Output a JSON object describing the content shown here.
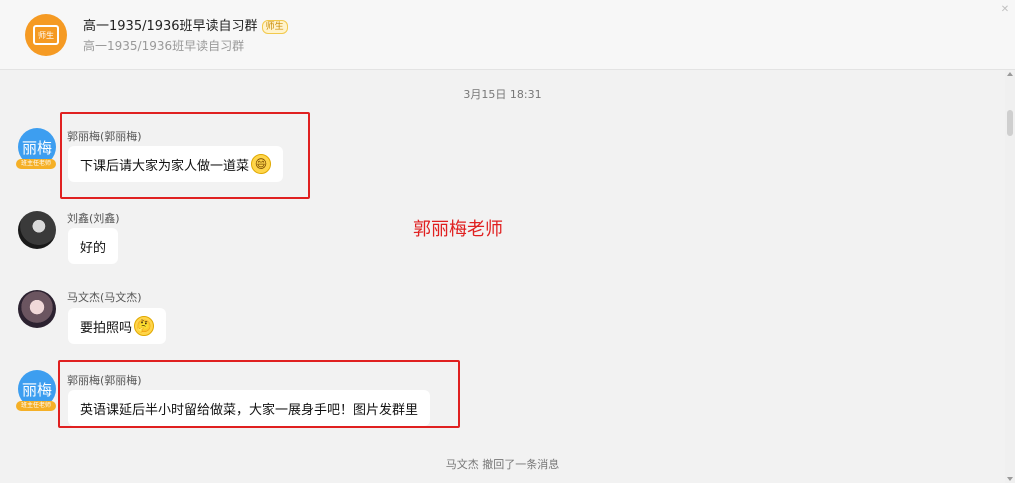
{
  "header": {
    "group_title": "高一1935/1936班早读自习群",
    "role_badge": "师生",
    "group_subtitle": "高一1935/1936班早读自习群",
    "avatar_label": "师生",
    "close_glyph": "✕"
  },
  "chat": {
    "timestamp": "3月15日 18:31",
    "annotation": "郭丽梅老师",
    "recall_notice": "马文杰 撤回了一条消息",
    "messages": [
      {
        "sender": "郭丽梅(郭丽梅)",
        "avatar_text": "丽梅",
        "avatar_badge": "班主任老师",
        "text": "下课后请大家为家人做一道菜",
        "emoji": "😄",
        "emoji_name": "grinning-face-icon"
      },
      {
        "sender": "刘鑫(刘鑫)",
        "text": "好的"
      },
      {
        "sender": "马文杰(马文杰)",
        "text": "要拍照吗",
        "emoji": "🤔",
        "emoji_name": "thinking-face-icon"
      },
      {
        "sender": "郭丽梅(郭丽梅)",
        "avatar_text": "丽梅",
        "avatar_badge": "班主任老师",
        "text": "英语课延后半小时留给做菜，大家一展身手吧！图片发群里"
      }
    ]
  },
  "colors": {
    "highlight_red": "#e02020",
    "teacher_avatar": "#3d9ef0",
    "group_avatar": "#f59a23"
  }
}
